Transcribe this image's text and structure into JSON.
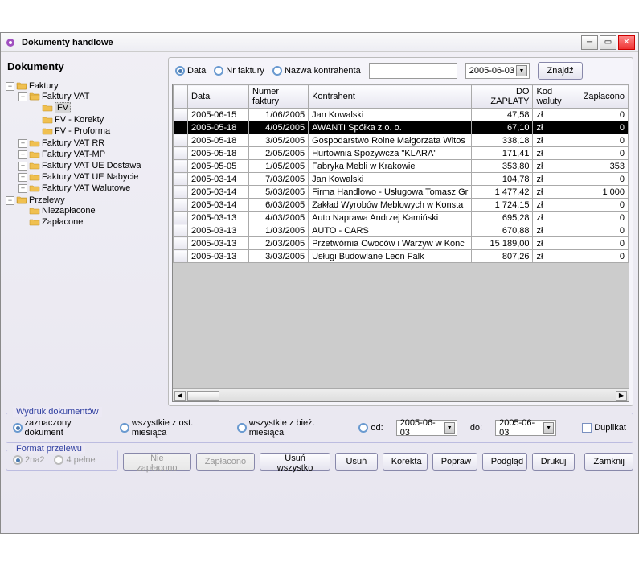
{
  "window": {
    "title": "Dokumenty handlowe"
  },
  "left": {
    "header": "Dokumenty",
    "tree": {
      "faktury": "Faktury",
      "faktury_vat": "Faktury VAT",
      "fv": "FV",
      "fv_korekty": "FV - Korekty",
      "fv_proforma": "FV - Proforma",
      "faktury_vat_rr": "Faktury VAT RR",
      "faktury_vat_mp": "Faktury VAT-MP",
      "faktury_vat_ue_dostawa": "Faktury VAT UE Dostawa",
      "faktury_vat_ue_nabycie": "Faktury VAT UE Nabycie",
      "faktury_vat_walutowe": "Faktury VAT Walutowe",
      "przelewy": "Przelewy",
      "niezaplacone": "Niezapłacone",
      "zaplacone": "Zapłacone"
    }
  },
  "search": {
    "radio_data": "Data",
    "radio_nr": "Nr faktury",
    "radio_nazwa": "Nazwa kontrahenta",
    "date": "2005-06-03",
    "find": "Znajdź"
  },
  "grid": {
    "columns": {
      "data": "Data",
      "numer": "Numer faktury",
      "kontrahent": "Kontrahent",
      "dozaplaty": "DO ZAPŁATY",
      "kodwaluty": "Kod waluty",
      "zaplacono": "Zapłacono"
    },
    "rows": [
      {
        "data": "2005-06-15",
        "numer": "1/06/2005",
        "kontr": "Jan Kowalski",
        "kwota": "47,58",
        "kw": "zł",
        "zap": "0"
      },
      {
        "data": "2005-05-18",
        "numer": "4/05/2005",
        "kontr": "AWANTI Spółka z o. o.",
        "kwota": "67,10",
        "kw": "zł",
        "zap": "0"
      },
      {
        "data": "2005-05-18",
        "numer": "3/05/2005",
        "kontr": "Gospodarstwo Rolne Małgorzata Witos",
        "kwota": "338,18",
        "kw": "zł",
        "zap": "0"
      },
      {
        "data": "2005-05-18",
        "numer": "2/05/2005",
        "kontr": "Hurtownia Spożywcza \"KLARA\"",
        "kwota": "171,41",
        "kw": "zł",
        "zap": "0"
      },
      {
        "data": "2005-05-05",
        "numer": "1/05/2005",
        "kontr": "Fabryka Mebli w Krakowie",
        "kwota": "353,80",
        "kw": "zł",
        "zap": "353"
      },
      {
        "data": "2005-03-14",
        "numer": "7/03/2005",
        "kontr": "Jan Kowalski",
        "kwota": "104,78",
        "kw": "zł",
        "zap": "0"
      },
      {
        "data": "2005-03-14",
        "numer": "5/03/2005",
        "kontr": "Firma Handlowo - Usługowa Tomasz Gr",
        "kwota": "1 477,42",
        "kw": "zł",
        "zap": "1 000"
      },
      {
        "data": "2005-03-14",
        "numer": "6/03/2005",
        "kontr": "Zakład Wyrobów Meblowych w Konsta",
        "kwota": "1 724,15",
        "kw": "zł",
        "zap": "0"
      },
      {
        "data": "2005-03-13",
        "numer": "4/03/2005",
        "kontr": "Auto Naprawa Andrzej Kamiński",
        "kwota": "695,28",
        "kw": "zł",
        "zap": "0"
      },
      {
        "data": "2005-03-13",
        "numer": "1/03/2005",
        "kontr": "AUTO - CARS",
        "kwota": "670,88",
        "kw": "zł",
        "zap": "0"
      },
      {
        "data": "2005-03-13",
        "numer": "2/03/2005",
        "kontr": "Przetwórnia Owoców i Warzyw w Konc",
        "kwota": "15 189,00",
        "kw": "zł",
        "zap": "0"
      },
      {
        "data": "2005-03-13",
        "numer": "3/03/2005",
        "kontr": "Usługi Budowlane Leon Falk",
        "kwota": "807,26",
        "kw": "zł",
        "zap": "0"
      }
    ]
  },
  "print": {
    "legend": "Wydruk dokumentów",
    "r1": "zaznaczony dokument",
    "r2": "wszystkie z ost. miesiąca",
    "r3": "wszystkie z bież. miesiąca",
    "r4": "od:",
    "do": "do:",
    "date1": "2005-06-03",
    "date2": "2005-06-03",
    "dup": "Duplikat"
  },
  "fmt": {
    "legend": "Format przelewu",
    "r1": "2na2",
    "r2": "4 pełne"
  },
  "buttons": {
    "niezaplacono": "Nie zapłacono",
    "zaplacono": "Zapłacono",
    "usunwszystko": "Usuń wszystko",
    "usun": "Usuń",
    "korekta": "Korekta",
    "popraw": "Popraw",
    "podglad": "Podgląd",
    "drukuj": "Drukuj",
    "zamknij": "Zamknij"
  }
}
